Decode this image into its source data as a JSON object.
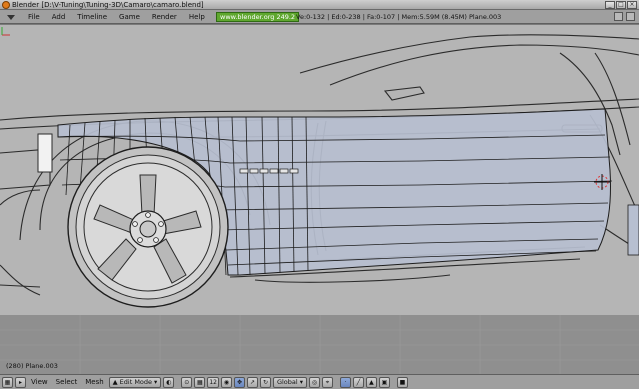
{
  "window": {
    "title": "Blender [D:\\V-Tuning\\Tuning-3D\\Camaro\\camaro.blend]",
    "buttons": [
      "_",
      "□",
      "×"
    ]
  },
  "menubar": {
    "items": [
      "File",
      "Add",
      "Timeline",
      "Game",
      "Render",
      "Help"
    ],
    "url_badge": "www.blender.org 249.2",
    "stats": "Ve:0-132 | Ed:0-238 | Fa:0-107 | Mem:5.59M (8.45M) Plane.003"
  },
  "viewport": {
    "info_label": "(280) Plane.003",
    "background_color": "#b5b5b5",
    "mesh_fill_color": "#b7bfd0"
  },
  "toolbar": {
    "view_label": "View",
    "select_label": "Select",
    "mesh_label": "Mesh",
    "mode_label": "Edit Mode",
    "layer_number": "12",
    "orientation_label": "Global"
  }
}
